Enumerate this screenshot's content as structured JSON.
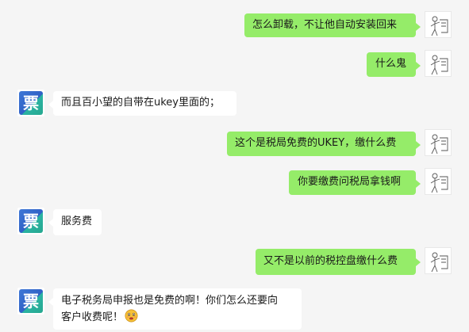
{
  "messages": [
    {
      "side": "me",
      "text": "怎么卸载，不让他自动安装回来"
    },
    {
      "side": "me",
      "text": "什么鬼"
    },
    {
      "side": "other",
      "text": "而且百小望的自带在ukey里面的；"
    },
    {
      "side": "me",
      "text": "这个是税局免费的UKEY，缴什么费"
    },
    {
      "side": "me",
      "text": "你要缴费问税局拿钱啊"
    },
    {
      "side": "other",
      "text": "服务费"
    },
    {
      "side": "me",
      "text": "又不是以前的税控盘缴什么费"
    },
    {
      "side": "other",
      "text_line1": "电子税务局申报也是免费的啊！你们怎么还要向",
      "text_line2": "客户收费呢！"
    }
  ],
  "avatar_other_char": "票",
  "emoji_name": "awkward-face-emoji",
  "colors": {
    "my_bubble": "#95ec69",
    "other_bubble": "#ffffff",
    "background": "#f5f5f5",
    "avatar_blue": "#3f78d6",
    "avatar_green": "#2bb3a3"
  }
}
